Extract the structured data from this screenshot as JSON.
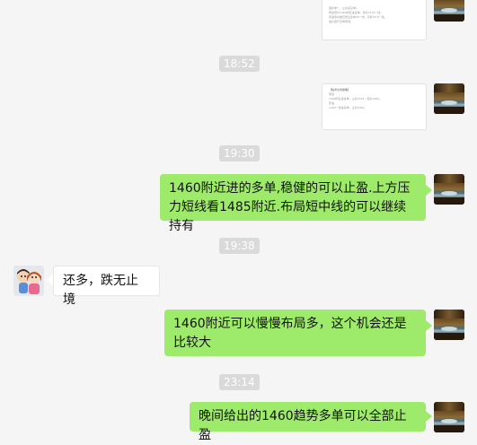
{
  "conversation": {
    "top_image": {
      "lines": [
        "盈利单一，止损多空单。",
        "黄金现价1460附近进多单，目标1470一线。",
        "原油现价做空附近多单45一线，目标55.8一线。",
        "油价回升空单离场。"
      ]
    },
    "timestamps": [
      "18:52",
      "19:30",
      "19:38",
      "23:14"
    ],
    "second_image": {
      "lines": [
        "【晚间交易策略】",
        "黄金",
        "1460附近进多单，止损1450，目标1480。",
        "原油",
        "1490一线进多单，止损1480。"
      ]
    },
    "messages": [
      {
        "side": "right",
        "text": "1460附近进的多单,稳健的可以止盈.上方压力短线看1485附近.布局短中线的可以继续持有"
      },
      {
        "side": "left",
        "text": "还多，跌无止境"
      },
      {
        "side": "right",
        "text": "1460附近可以慢慢布局多，这个机会还是比较大"
      },
      {
        "side": "right",
        "text": "晚间给出的1460趋势多单可以全部止盈"
      }
    ]
  },
  "colors": {
    "background": "#f5f5f5",
    "own_bubble": "#9eea6a",
    "peer_bubble": "#ffffff",
    "timestamp": "#dadada"
  }
}
